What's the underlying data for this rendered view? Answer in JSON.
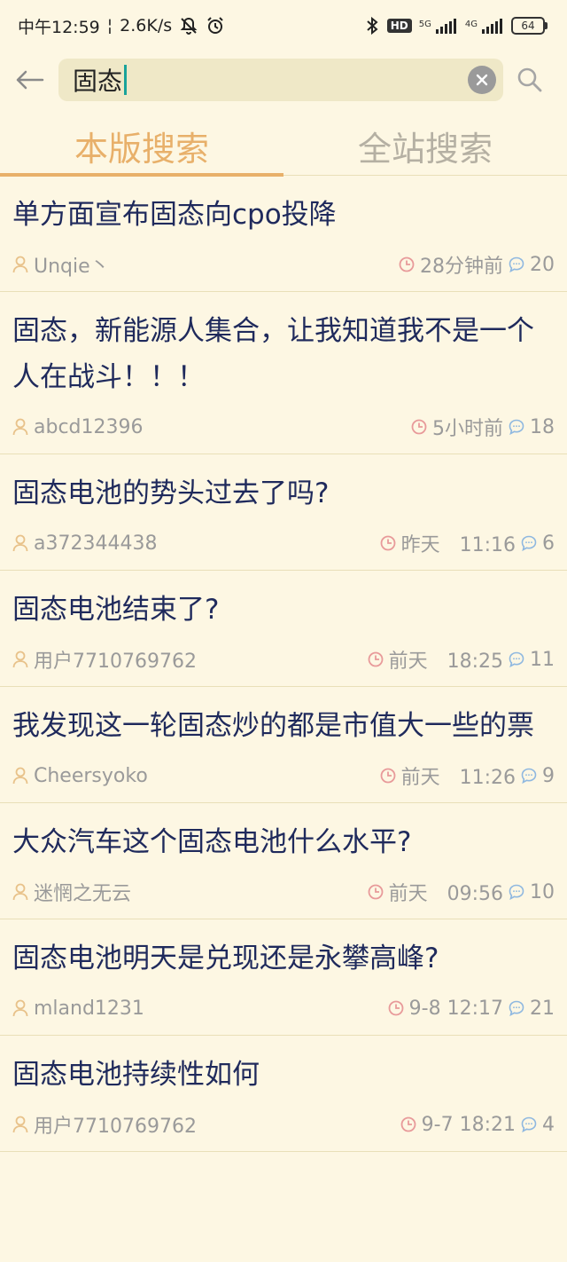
{
  "status_bar": {
    "time": "中午12:59",
    "separator": "¦",
    "net_speed": "2.6K/s",
    "hd_label": "HD",
    "net1_label": "5G",
    "net2_label": "4G",
    "battery": "64"
  },
  "search": {
    "query": "固态"
  },
  "tabs": [
    {
      "label": "本版搜索",
      "active": true
    },
    {
      "label": "全站搜索",
      "active": false
    }
  ],
  "colors": {
    "accent": "#e8b06a",
    "background": "#fdf7e3",
    "title": "#1f2a5c",
    "meta": "#9a9a9a",
    "time_icon": "#e89a9a",
    "comment_icon": "#8fb8e0"
  },
  "posts": [
    {
      "title": "单方面宣布固态向cpo投降",
      "author": "Unqie丶",
      "time": "28分钟前",
      "comments": "20"
    },
    {
      "title": "固态，新能源人集合，让我知道我不是一个人在战斗！！！",
      "author": "abcd12396",
      "time": "5小时前",
      "comments": "18"
    },
    {
      "title": "固态电池的势头过去了吗?",
      "author": "a372344438",
      "time": "昨天　11:16",
      "comments": "6"
    },
    {
      "title": "固态电池结束了?",
      "author": "用户7710769762",
      "time": "前天　18:25",
      "comments": "11"
    },
    {
      "title": "我发现这一轮固态炒的都是市值大一些的票",
      "author": "Cheersyoko",
      "time": "前天　11:26",
      "comments": "9"
    },
    {
      "title": "大众汽车这个固态电池什么水平?",
      "author": "迷惘之无云",
      "time": "前天　09:56",
      "comments": "10"
    },
    {
      "title": "固态电池明天是兑现还是永攀高峰?",
      "author": "mland1231",
      "time": "9-8 12:17",
      "comments": "21"
    },
    {
      "title": "固态电池持续性如何",
      "author": "用户7710769762",
      "time": "9-7 18:21",
      "comments": "4"
    }
  ]
}
